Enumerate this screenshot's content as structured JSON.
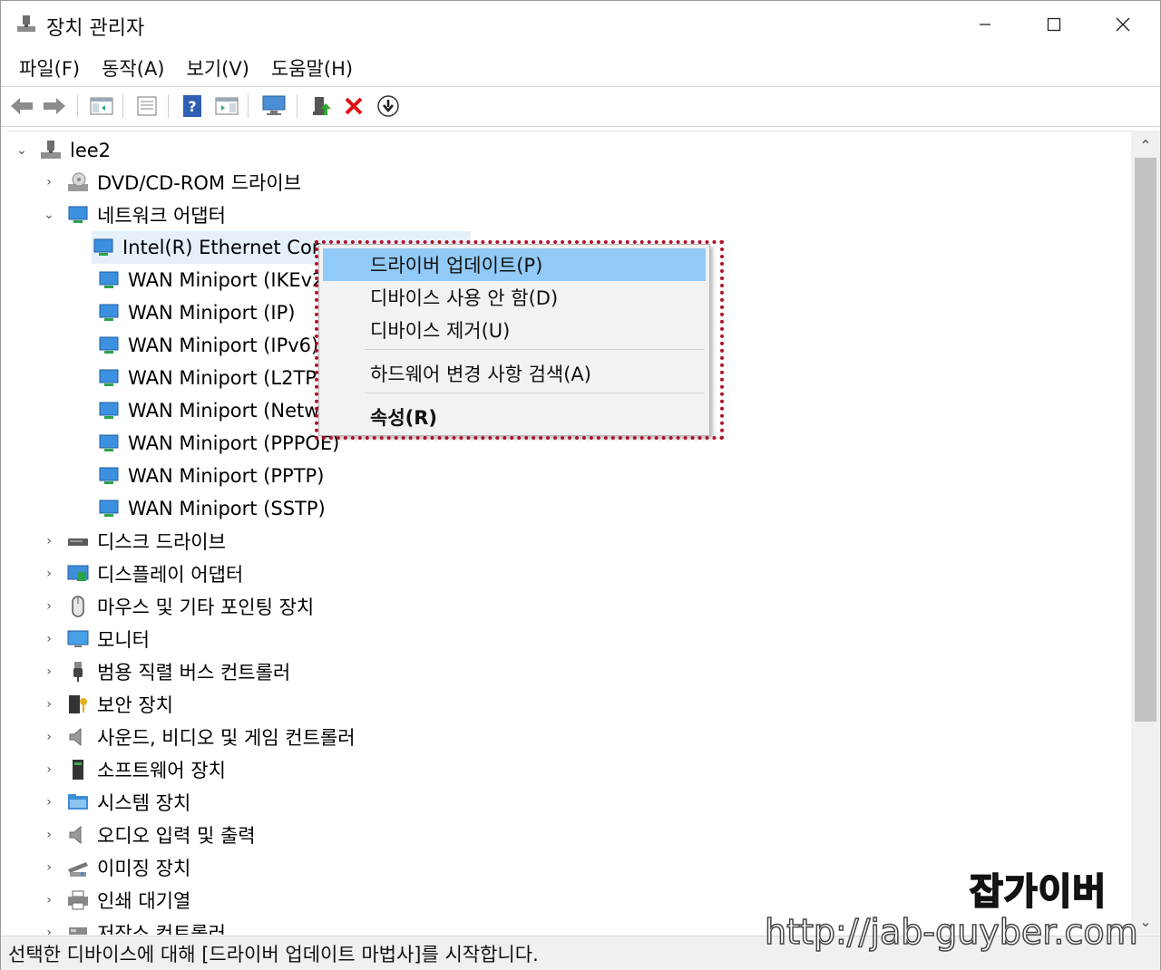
{
  "window": {
    "title": "장치 관리자"
  },
  "menubar": [
    "파일(F)",
    "동작(A)",
    "보기(V)",
    "도움말(H)"
  ],
  "toolbar": {
    "icons": [
      "back-arrow-icon",
      "forward-arrow-icon",
      "show-hide-console-tree-icon",
      "properties-icon",
      "help-icon",
      "action-pane-icon",
      "scan-hardware-icon",
      "update-driver-icon",
      "uninstall-device-icon",
      "enable-device-icon"
    ]
  },
  "tree": {
    "root": "lee2",
    "categories": [
      {
        "label": "DVD/CD-ROM 드라이브",
        "icon": "dvd-drive-icon"
      },
      {
        "label": "네트워크 어댑터",
        "icon": "network-adapter-icon"
      },
      {
        "label": "디스크 드라이브",
        "icon": "disk-drive-icon"
      },
      {
        "label": "디스플레이 어댑터",
        "icon": "display-adapter-icon"
      },
      {
        "label": "마우스 및 기타 포인팅 장치",
        "icon": "mouse-icon"
      },
      {
        "label": "모니터",
        "icon": "monitor-icon"
      },
      {
        "label": "범용 직렬 버스 컨트롤러",
        "icon": "usb-icon"
      },
      {
        "label": "보안 장치",
        "icon": "security-device-icon"
      },
      {
        "label": "사운드, 비디오 및 게임 컨트롤러",
        "icon": "speaker-icon"
      },
      {
        "label": "소프트웨어 장치",
        "icon": "software-device-icon"
      },
      {
        "label": "시스템 장치",
        "icon": "system-device-icon"
      },
      {
        "label": "오디오 입력 및 출력",
        "icon": "audio-io-icon"
      },
      {
        "label": "이미징 장치",
        "icon": "imaging-device-icon"
      },
      {
        "label": "인쇄 대기열",
        "icon": "printer-icon"
      },
      {
        "label": "저장소 컨트롤러",
        "icon": "storage-controller-icon"
      }
    ],
    "network_children": [
      "Intel(R) Ethernet Con",
      "WAN Miniport (IKEv2",
      "WAN Miniport (IP)",
      "WAN Miniport (IPv6)",
      "WAN Miniport (L2TP",
      "WAN Miniport (Netw",
      "WAN Miniport (PPPOE)",
      "WAN Miniport (PPTP)",
      "WAN Miniport (SSTP)"
    ]
  },
  "context_menu": {
    "items": [
      "드라이버 업데이트(P)",
      "디바이스 사용 안 함(D)",
      "디바이스 제거(U)",
      "하드웨어 변경 사항 검색(A)",
      "속성(R)"
    ],
    "highlighted_index": 0
  },
  "status": "선택한 디바이스에 대해 [드라이버 업데이트 마법사]를 시작합니다.",
  "watermark": {
    "title": "잡가이버",
    "url": "http://jab-guyber.com"
  },
  "colors": {
    "menu_highlight": "#91c9f7",
    "annotation_box": "#b0122a",
    "selected_row": "#e5f0fb"
  }
}
